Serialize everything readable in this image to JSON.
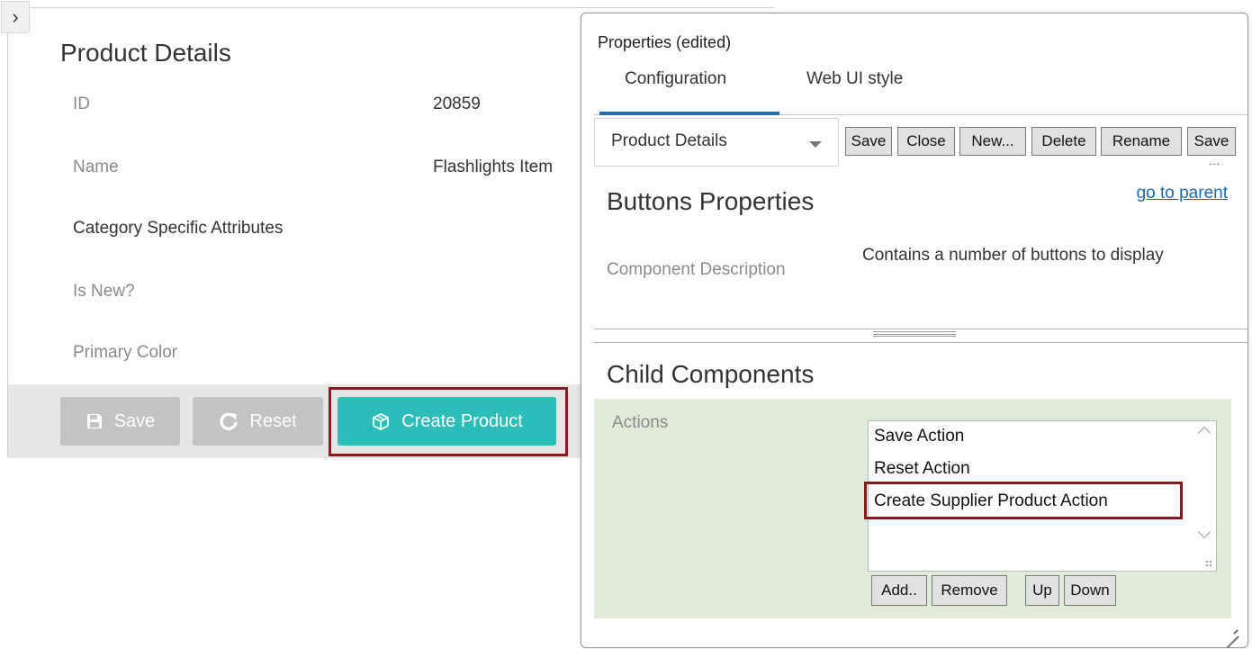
{
  "form": {
    "toggle_icon": "chevron-right-icon",
    "title": "Product Details",
    "fields": [
      {
        "label": "ID",
        "value": "20859"
      },
      {
        "label": "Name",
        "value": "Flashlights Item"
      },
      {
        "label": "Category Specific Attributes",
        "value": ""
      },
      {
        "label": "Is New?",
        "value": ""
      },
      {
        "label": "Primary Color",
        "value": ""
      }
    ],
    "buttons": {
      "save": {
        "label": "Save",
        "icon": "floppy-disk-icon"
      },
      "reset": {
        "label": "Reset",
        "icon": "refresh-icon"
      },
      "create": {
        "label": "Create Product",
        "icon": "package-icon"
      }
    },
    "colors": {
      "create_button": "#2cbcb9",
      "disabled_button": "#c3c3c3",
      "highlight": "#8b1a1a"
    }
  },
  "props": {
    "title": "Properties (edited)",
    "tabs": {
      "configuration": "Configuration",
      "web_ui_style": "Web UI style"
    },
    "component_select": {
      "selected": "Product Details"
    },
    "toolbar": {
      "save": "Save",
      "close": "Close",
      "new": "New...",
      "delete": "Delete",
      "rename": "Rename",
      "save_as": "Save",
      "save_as_overflow": "..."
    },
    "buttons_section": {
      "title": "Buttons Properties",
      "parent_link": "go to parent",
      "description_label": "Component Description",
      "description_value": "Contains a number of buttons to display"
    },
    "child_section": {
      "title": "Child Components",
      "actions_label": "Actions",
      "actions": [
        "Save Action",
        "Reset Action",
        "Create Supplier Product Action"
      ],
      "buttons": {
        "add": "Add..",
        "remove": "Remove",
        "up": "Up",
        "down": "Down"
      }
    },
    "colors": {
      "tab_accent": "#1e6fb5",
      "link": "#1c6ab3",
      "child_bg": "#e0ecd9"
    }
  }
}
